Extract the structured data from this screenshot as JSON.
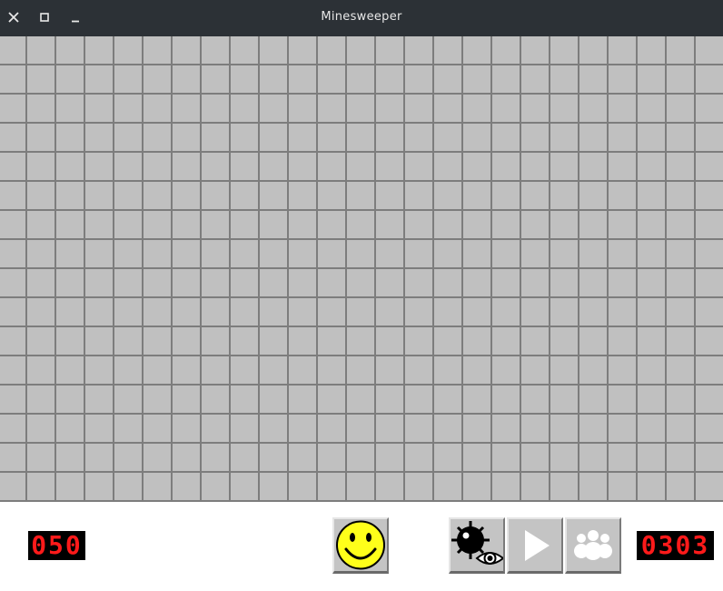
{
  "window": {
    "title": "Minesweeper",
    "controls": [
      "close-icon",
      "maximize-icon",
      "minimize-icon"
    ]
  },
  "board": {
    "columns": 25,
    "rows": 16,
    "cell_state": "covered"
  },
  "status": {
    "mine_counter": "050",
    "timer": "0303"
  },
  "toolbar": {
    "buttons": [
      {
        "name": "new-game-button",
        "icon": "smiley-face-icon"
      },
      {
        "name": "reveal-mines-button",
        "icon": "mine-eye-icon"
      },
      {
        "name": "play-button",
        "icon": "play-icon"
      },
      {
        "name": "multiplayer-button",
        "icon": "people-icon"
      }
    ]
  },
  "colors": {
    "titlebar": "#2c3136",
    "cell": "#c0c0c0",
    "grid_line": "#7d7d7d",
    "led_digits": "#ff1a1a",
    "smiley": "#ffff1a"
  }
}
